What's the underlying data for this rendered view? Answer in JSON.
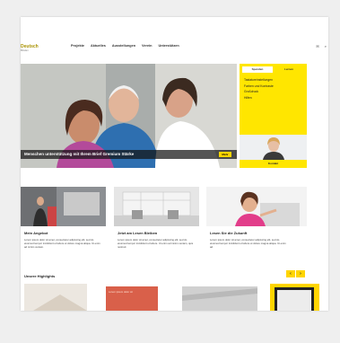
{
  "header": {
    "logo_text": "Deutsch",
    "logo_sub": "Blinden",
    "nav": [
      "Projekte",
      "Aktuelles",
      "Ausstellungen",
      "Verein",
      "Unterstützen"
    ],
    "utility": [
      "✉",
      "⌕"
    ]
  },
  "hero": {
    "caption": "Menschen unterstützung mit Ihrem Brief Gremium Stärke",
    "button": "Mehr"
  },
  "side": {
    "tabs": [
      "Spenden",
      "Lernen"
    ],
    "links": [
      "Tastatureinstellungen",
      "Farben und Kontraste",
      "Großdruck",
      "Hilfen"
    ],
    "strip": "Kontakt"
  },
  "cards": [
    {
      "title": "Mein Angebot",
      "text": "Lorem ipsum dolor sit amet, consectetur adipiscing elit, sed do eiusmod tempor incididunt ut labore et dolore magna aliqua. Ut enim ad minim veniam."
    },
    {
      "title": "Jetzt am Lesen Bleiben",
      "text": "Lorem ipsum dolor sit amet, consectetur adipiscing elit, sed do eiusmod tempor incididunt ut labore. Ut enim ad minim veniam, quis nostrud."
    },
    {
      "title": "Lesen Sie die Zukunft",
      "text": "Lorem ipsum dolor sit amet, consectetur adipiscing elit, sed do eiusmod tempor incididunt ut labore et dolore magna aliqua. Ut enim ad."
    }
  ],
  "highlights": {
    "title": "Unsere Highlights",
    "pager": [
      "‹",
      "›"
    ],
    "item2_text": "Lorem ipsum dolor sit"
  },
  "colors": {
    "brand_yellow": "#ffe600",
    "accent_orange": "#d9604a"
  }
}
